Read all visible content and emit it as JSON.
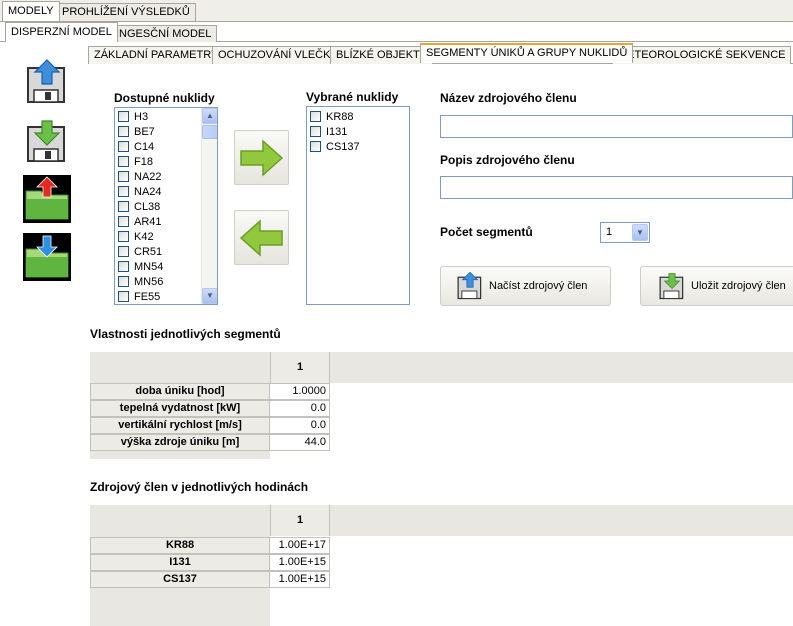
{
  "top_tabs": [
    {
      "label": "MODELY",
      "active": true
    },
    {
      "label": "PROHLÍŽENÍ VÝSLEDKŮ",
      "active": false
    }
  ],
  "model_tabs": [
    {
      "label": "DISPERZNÍ MODEL",
      "active": true
    },
    {
      "label": "INGESČNÍ MODEL",
      "active": false
    }
  ],
  "sub_tabs": [
    {
      "label": "ZÁKLADNÍ PARAMETRY",
      "active": false
    },
    {
      "label": "OCHUZOVÁNÍ VLEČKY",
      "active": false
    },
    {
      "label": "BLÍZKÉ OBJEKTY",
      "active": false
    },
    {
      "label": "SEGMENTY ÚNIKŮ A GRUPY NUKLIDŮ",
      "active": true
    },
    {
      "label": "METEOROLOGICKÉ SEKVENCE",
      "active": false
    }
  ],
  "side_icons": [
    "disk-upload-icon",
    "disk-download-icon",
    "folder-upload-icon",
    "folder-download-icon"
  ],
  "available": {
    "title": "Dostupné nuklidy",
    "items": [
      "H3",
      "BE7",
      "C14",
      "F18",
      "NA22",
      "NA24",
      "CL38",
      "AR41",
      "K42",
      "CR51",
      "MN54",
      "MN56",
      "FE55"
    ]
  },
  "selected": {
    "title": "Vybrané nuklidy",
    "items": [
      "KR88",
      "I131",
      "CS137"
    ]
  },
  "source": {
    "name_label": "Název zdrojového členu",
    "name_value": "",
    "desc_label": "Popis zdrojového členu",
    "desc_value": "",
    "segments_label": "Počet segmentů",
    "segments_value": "1",
    "load_label": "Načíst zdrojový člen",
    "save_label": "Uložit zdrojový člen"
  },
  "segments_table": {
    "title": "Vlastnosti jednotlivých segmentů",
    "column": "1",
    "rows": [
      {
        "label": "doba úniku [hod]",
        "value": "1.0000"
      },
      {
        "label": "tepelná vydatnost [kW]",
        "value": "0.0"
      },
      {
        "label": "vertikální rychlost [m/s]",
        "value": "0.0"
      },
      {
        "label": "výška zdroje úniku [m]",
        "value": "44.0"
      }
    ]
  },
  "hourly_table": {
    "title": "Zdrojový člen v jednotlivých hodinách",
    "column": "1",
    "rows": [
      {
        "label": "KR88",
        "value": "1.00E+17"
      },
      {
        "label": "I131",
        "value": "1.00E+15"
      },
      {
        "label": "CS137",
        "value": "1.00E+15"
      }
    ]
  }
}
